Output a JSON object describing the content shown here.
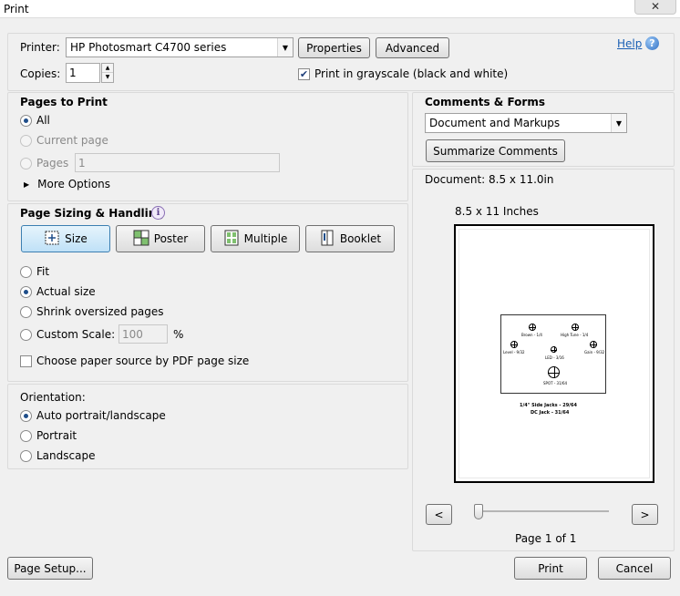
{
  "window": {
    "title": "Print",
    "close_icon": "✕"
  },
  "printer": {
    "label": "Printer:",
    "selected": "HP Photosmart C4700 series",
    "properties_label": "Properties",
    "advanced_label": "Advanced",
    "help_label": "Help",
    "copies_label": "Copies:",
    "copies_value": "1",
    "grayscale_label": "Print in grayscale (black and white)",
    "grayscale_checked": true
  },
  "pages_to_print": {
    "title": "Pages to Print",
    "all_label": "All",
    "current_label": "Current page",
    "pages_label": "Pages",
    "pages_value": "1",
    "more_options_label": "More Options"
  },
  "sizing": {
    "title": "Page Sizing & Handling",
    "tabs": [
      "Size",
      "Poster",
      "Multiple",
      "Booklet"
    ],
    "fit_label": "Fit",
    "actual_label": "Actual size",
    "shrink_label": "Shrink oversized pages",
    "custom_label": "Custom Scale:",
    "custom_value": "100",
    "percent": "%",
    "paper_source_label": "Choose paper source by PDF page size"
  },
  "orientation": {
    "title": "Orientation:",
    "auto_label": "Auto portrait/landscape",
    "portrait_label": "Portrait",
    "landscape_label": "Landscape"
  },
  "comments": {
    "title": "Comments & Forms",
    "selected": "Document and Markups",
    "summarize_label": "Summarize Comments"
  },
  "preview": {
    "document_size": "Document: 8.5 x 11.0in",
    "paper_size": "8.5 x 11 Inches",
    "page_indicator": "Page 1 of 1",
    "prev_label": "<",
    "next_label": ">",
    "page_content": {
      "brown": "Brown - 1/4",
      "high_tune": "High Tune - 1/4",
      "level": "Level - 9/32",
      "gain": "Gain - 9/32",
      "led": "LED - 3/16",
      "spot": "SPOT - 31/64",
      "side_jacks": "1/4\" Side Jacks - 29/64",
      "dc_jack": "DC Jack - 31/64"
    }
  },
  "footer": {
    "page_setup_label": "Page Setup...",
    "print_label": "Print",
    "cancel_label": "Cancel"
  },
  "colors": {
    "accent": "#1a5fb4",
    "active_tab": "#bfe1f7"
  }
}
